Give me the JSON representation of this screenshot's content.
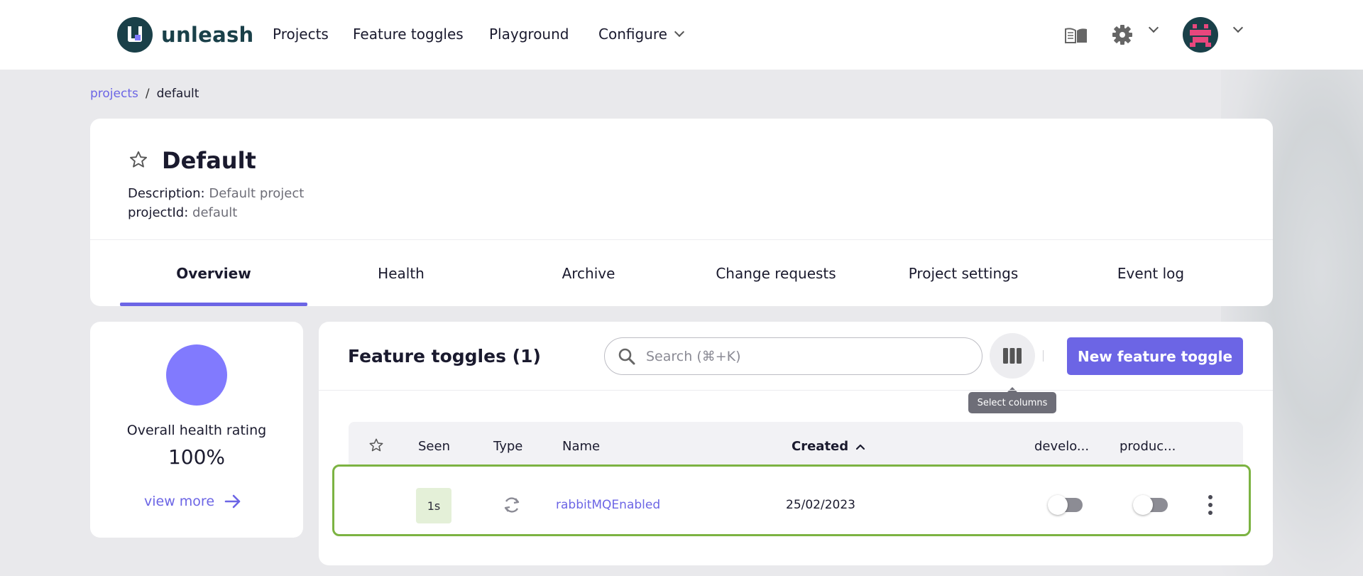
{
  "app": {
    "name": "unleash"
  },
  "nav": {
    "projects": "Projects",
    "feature_toggles": "Feature toggles",
    "playground": "Playground",
    "configure": "Configure"
  },
  "breadcrumb": {
    "link": "projects",
    "separator": "/",
    "current": "default"
  },
  "project": {
    "title": "Default",
    "description_key": "Description:",
    "description_value": "Default project",
    "id_key": "projectId:",
    "id_value": "default"
  },
  "tabs": [
    {
      "label": "Overview",
      "active": true
    },
    {
      "label": "Health"
    },
    {
      "label": "Archive"
    },
    {
      "label": "Change requests"
    },
    {
      "label": "Project settings"
    },
    {
      "label": "Event log"
    }
  ],
  "health": {
    "label": "Overall health rating",
    "value": "100%",
    "link": "view more",
    "color": "#817afe"
  },
  "toggles": {
    "title": "Feature toggles (1)",
    "search_placeholder": "Search (⌘+K)",
    "columns_tooltip": "Select columns",
    "new_button": "New feature toggle",
    "columns": {
      "seen": "Seen",
      "type": "Type",
      "name": "Name",
      "created": "Created",
      "development": "develo...",
      "production": "produc..."
    },
    "rows": [
      {
        "seen": "1s",
        "type_icon": "release-icon",
        "name": "rabbitMQEnabled",
        "created": "25/02/2023",
        "development_enabled": false,
        "production_enabled": false
      }
    ]
  },
  "colors": {
    "accent": "#6c65e5",
    "brand_dark": "#1a4049",
    "highlight_border": "#7cb342",
    "seen_badge": "#e4f0d8"
  }
}
